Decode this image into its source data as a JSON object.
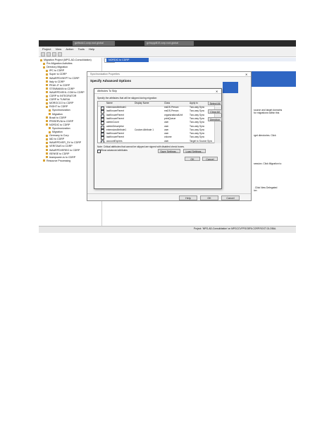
{
  "window": {
    "tabs": [
      "gwfsvdc1.corp.root.global",
      "gvhspgdil19.corp.root.global"
    ]
  },
  "menu": [
    "Project",
    "View",
    "Action",
    "Tools",
    "Help"
  ],
  "tree": {
    "items": [
      {
        "label": "Migration Project (MPG-AD-Consolidation)",
        "indent": 0
      },
      {
        "label": "Pre-Migration Activities",
        "indent": 1
      },
      {
        "label": "Directory Migration",
        "indent": 1
      },
      {
        "label": "IPC to CDRP",
        "indent": 2
      },
      {
        "label": "Super to CDRP",
        "indent": 2
      },
      {
        "label": "WAARPDVSEPT to CDRP",
        "indent": 2
      },
      {
        "label": "Italy to CDRP",
        "indent": 2
      },
      {
        "label": "PEAK-IT to CDRP",
        "indent": 2
      },
      {
        "label": "STEMMANN to CDRP",
        "indent": 2
      },
      {
        "label": "WAARPDVEHL.COM to CDRP",
        "indent": 2
      },
      {
        "label": "CDRP to INTEGRATOR",
        "indent": 2
      },
      {
        "label": "CDRP to TUNISIA",
        "indent": 2
      },
      {
        "label": "MOROCCO to CDRP",
        "indent": 2
      },
      {
        "label": "RIGHT to CDRP",
        "indent": 2
      },
      {
        "label": "Synchronization",
        "indent": 3
      },
      {
        "label": "Migration",
        "indent": 3
      },
      {
        "label": "Brazil to CDRP",
        "indent": 2
      },
      {
        "label": "PRISERVIA to CDRP",
        "indent": 2
      },
      {
        "label": "NORDIC to CDRP",
        "indent": 2
      },
      {
        "label": "Synchronization",
        "indent": 3
      },
      {
        "label": "Migration",
        "indent": 3
      },
      {
        "label": "Germany to Corp",
        "indent": 2
      },
      {
        "label": "IAD to CDRP",
        "indent": 2
      },
      {
        "label": "WAARPDVER_DV to CDRP",
        "indent": 2
      },
      {
        "label": "VERITAAS to CDRP",
        "indent": 2
      },
      {
        "label": "WAARPDVEREG to CDRP",
        "indent": 2
      },
      {
        "label": "ISENSE to CDRP",
        "indent": 2
      },
      {
        "label": "teampower-rs to CDRP",
        "indent": 2
      },
      {
        "label": "Resource Processing",
        "indent": 1
      }
    ]
  },
  "right_pane": {
    "header": "NORDIC to CDRP",
    "tab": "Tasks",
    "side_texts": [
      "source and target domains",
      "for migrations within this",
      "rget directories. Click",
      "session. Click Migration to",
      ". Click New Delegated",
      "ion"
    ]
  },
  "sync_dialog": {
    "title": "Synchronization Properties",
    "heading": "Specify Advanced Options",
    "buttons": {
      "help": "Help",
      "ok": "OK",
      "cancel": "Cancel"
    }
  },
  "skip_dialog": {
    "title": "Attributes To Skip",
    "description": "Specify the attributes that will be skipped during migration:",
    "columns": [
      "Name",
      "Display Name",
      "Class",
      "Apply to"
    ],
    "rows": [
      {
        "checked": true,
        "name": "extensionAttribute1",
        "display": "",
        "cls": "msDS-Person",
        "apply": "Two-way Sync"
      },
      {
        "checked": true,
        "name": "lastKnownParent",
        "display": "",
        "cls": "msDS-Person",
        "apply": "Two-way Sync"
      },
      {
        "checked": true,
        "name": "lastKnownParent",
        "display": "",
        "cls": "organizationalUnit",
        "apply": "Two-way Sync"
      },
      {
        "checked": true,
        "name": "lastKnownParent",
        "display": "",
        "cls": "printQueue",
        "apply": "Two-way Sync"
      },
      {
        "checked": true,
        "name": "adminCount",
        "display": "",
        "cls": "user",
        "apply": "Two-way Sync"
      },
      {
        "checked": true,
        "name": "adminDescription",
        "display": "",
        "cls": "user",
        "apply": "Two-way Sync"
      },
      {
        "checked": true,
        "name": "extensionAttribute1",
        "display": "Custom Attribute 1",
        "cls": "user",
        "apply": "Two-way Sync"
      },
      {
        "checked": true,
        "name": "lastKnownParent",
        "display": "",
        "cls": "user",
        "apply": "Two-way Sync"
      },
      {
        "checked": true,
        "name": "lastKnownParent",
        "display": "",
        "cls": "volume",
        "apply": "Two-way Sync"
      },
      {
        "checked": true,
        "name": "accountExpires",
        "display": "",
        "cls": "user",
        "apply": "Target to Source Sync"
      }
    ],
    "side_buttons": {
      "select_all": "Select All",
      "clear_all": "Clear All",
      "direction": "Direction"
    },
    "note": "Note: Critical attributes that cannot be skipped are signed with disabled check boxes.",
    "show_advanced": {
      "label": "Show advanced attributes",
      "checked": true
    },
    "buttons": {
      "save": "Save Settings...",
      "load": "Load Settings...",
      "ok": "OK",
      "cancel": "Cancel"
    }
  },
  "status_bar": {
    "text": "Project: 'MPG-AD-Consolidation' on MPGCCVFPGO8F6.CORP.ROOT.GLOBAL"
  },
  "colors": {
    "accent": "#2f66c3",
    "titlebar": "#2a2a2a",
    "checkmark": "#1a4fb0"
  }
}
